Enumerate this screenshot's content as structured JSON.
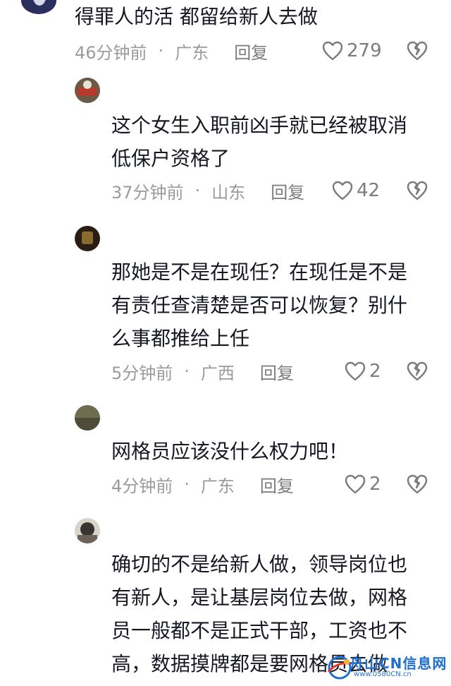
{
  "comments": [
    {
      "text": "得罪人的活   都留给新人去做",
      "time": "46分钟前",
      "separator": "·",
      "location": "广东",
      "reply_label": "回复",
      "likes": "279"
    },
    {
      "text": "这个女生入职前凶手就已经被取消\n低保户资格了",
      "time": "37分钟前",
      "separator": "·",
      "location": "山东",
      "reply_label": "回复",
      "likes": "42"
    },
    {
      "text": "那她是不是在现任？在现任是不是\n有责任查清楚是否可以恢复？别什\n么事都推给上任",
      "time": "5分钟前",
      "separator": "·",
      "location": "广西",
      "reply_label": "回复",
      "likes": "2"
    },
    {
      "text": "网格员应该没什么权力吧！",
      "time": "4分钟前",
      "separator": "·",
      "location": "广东",
      "reply_label": "回复",
      "likes": "2"
    },
    {
      "text": "确切的不是给新人做，领导岗位也\n有新人，是让基层岗位去做，网格\n员一般都不是正式干部，工资也不\n高，数据摸牌都是要网格员去做",
      "time": "",
      "separator": "",
      "location": "",
      "reply_label": "",
      "likes": ""
    }
  ],
  "watermark": {
    "brand": "舟山CN信息网",
    "url": "www.0580CN.cn"
  },
  "colors": {
    "text": "#161823",
    "meta": "#9a9a9f",
    "icon": "#7b7b80",
    "watermark": "#1f6fd1"
  },
  "icons": {
    "like": "heart-outline-icon",
    "dislike": "broken-heart-icon"
  }
}
